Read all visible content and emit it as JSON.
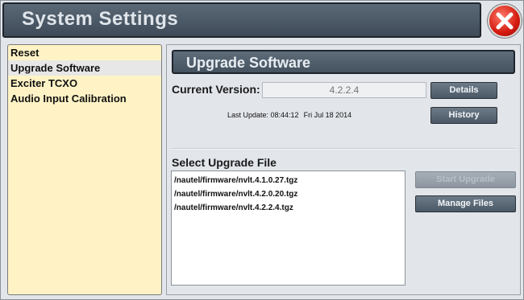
{
  "window": {
    "title": "System Settings",
    "close_icon": "close-icon"
  },
  "menu": {
    "items": [
      {
        "label": "Reset"
      },
      {
        "label": "Upgrade Software",
        "selected": true
      },
      {
        "label": "Exciter TCXO"
      },
      {
        "label": "Audio Input Calibration"
      }
    ]
  },
  "upgrade": {
    "section_title": "Upgrade Software",
    "current_version_label": "Current Version:",
    "current_version_value": "4.2.2.4",
    "details_button": "Details",
    "history_button": "History",
    "last_update_label": "Last Update: 08:44:12",
    "last_update_date": "Fri Jul 18 2014",
    "select_file_label": "Select Upgrade File",
    "files": [
      "/nautel/firmware/nvlt.4.1.0.27.tgz",
      "/nautel/firmware/nvlt.4.2.0.20.tgz",
      "/nautel/firmware/nvlt.4.2.2.4.tgz"
    ],
    "start_upgrade_button": "Start Upgrade",
    "manage_files_button": "Manage Files"
  },
  "colors": {
    "menu_background": "#fff3c6",
    "header_background": "#4f5c69",
    "close_button": "#d41b10"
  }
}
